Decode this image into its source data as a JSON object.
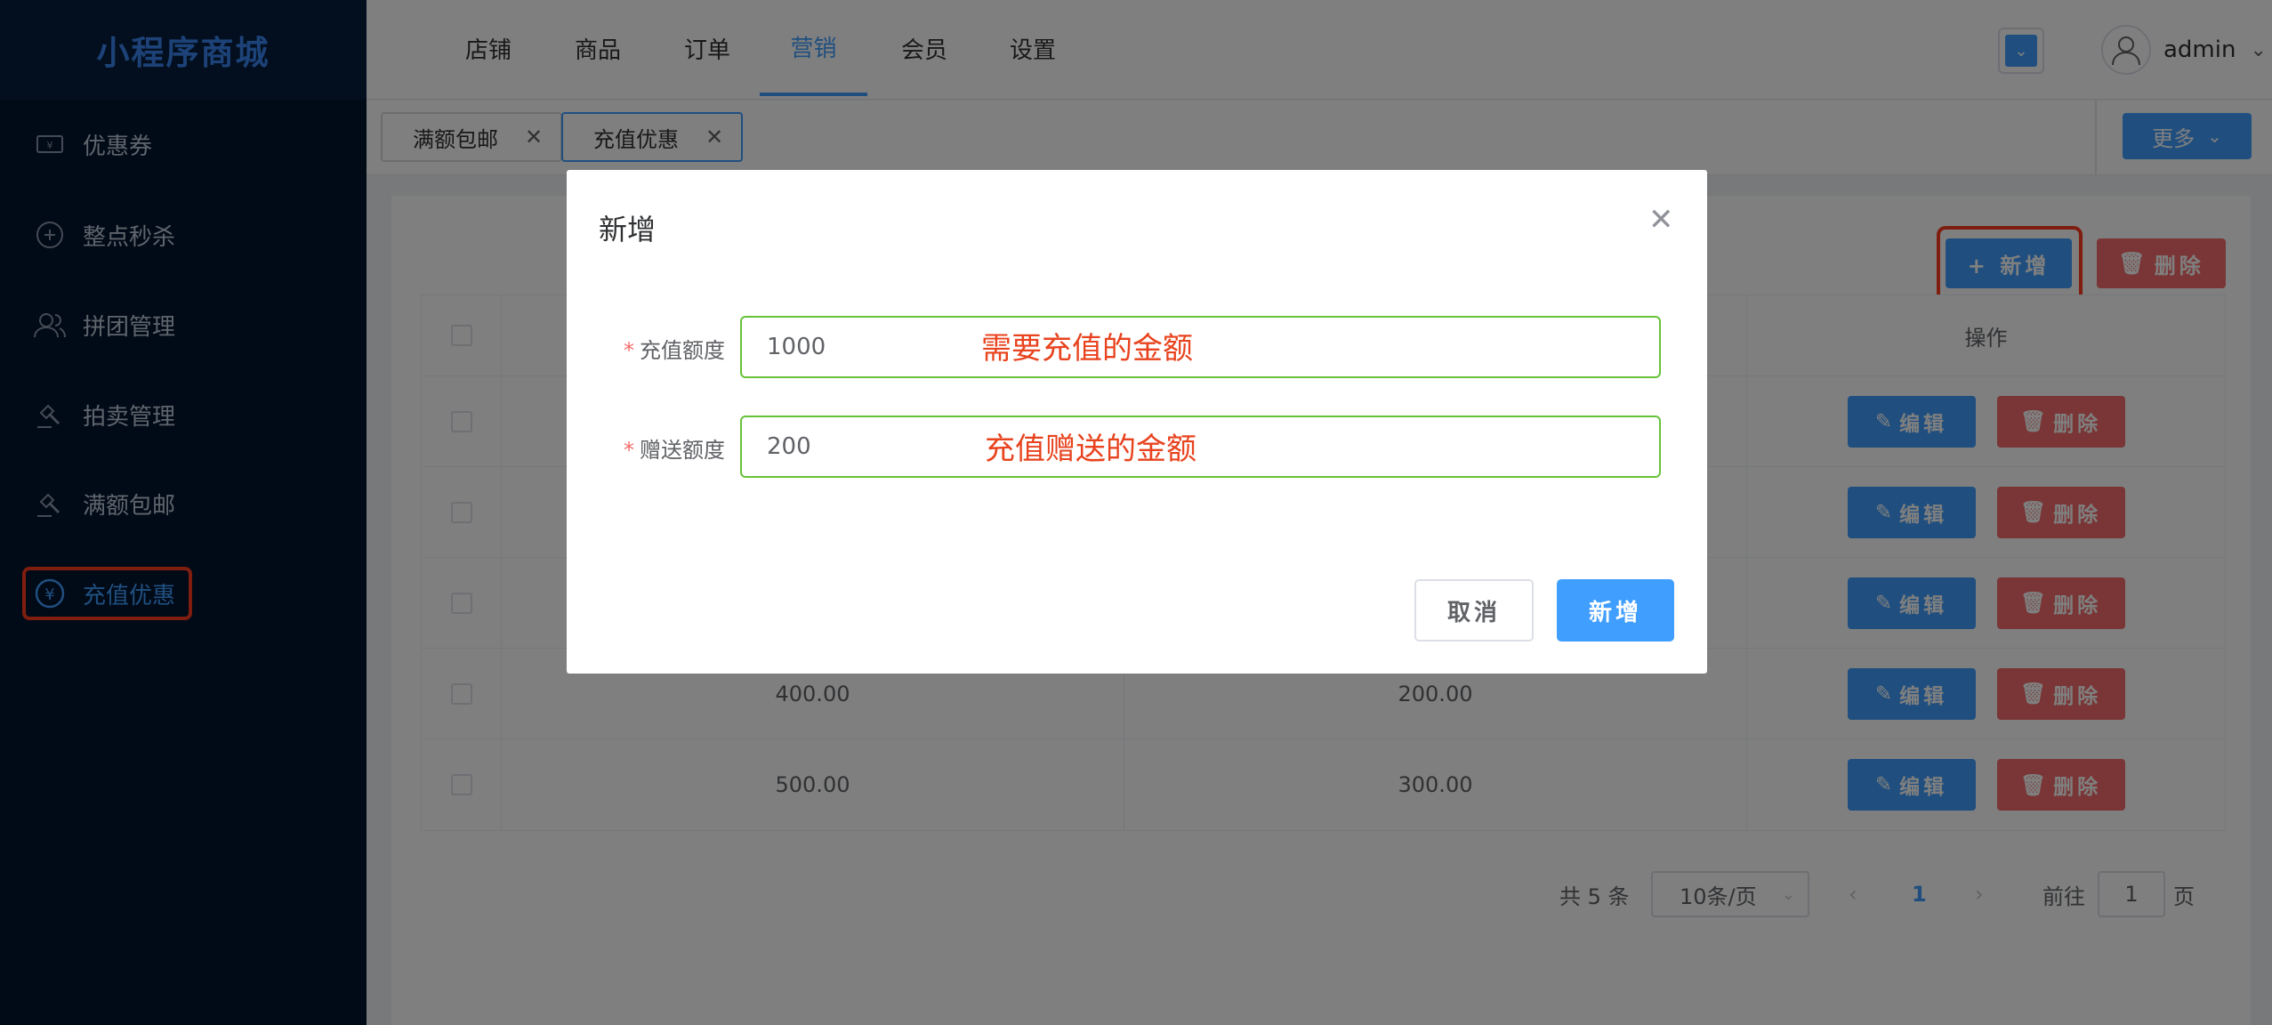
{
  "app": {
    "title": "小程序商城"
  },
  "sidebar": {
    "items": [
      {
        "label": "优惠券",
        "icon": "coupon-icon"
      },
      {
        "label": "整点秒杀",
        "icon": "flash-sale-icon"
      },
      {
        "label": "拼团管理",
        "icon": "group-icon"
      },
      {
        "label": "拍卖管理",
        "icon": "gavel-icon"
      },
      {
        "label": "满额包邮",
        "icon": "gavel-icon"
      },
      {
        "label": "充值优惠",
        "icon": "yen-icon",
        "active": true
      }
    ]
  },
  "topnav": {
    "items": [
      "店铺",
      "商品",
      "订单",
      "营销",
      "会员",
      "设置"
    ],
    "active": "营销",
    "user": "admin"
  },
  "tags": [
    {
      "label": "满额包邮"
    },
    {
      "label": "充值优惠",
      "active": true
    }
  ],
  "more_button": "更多",
  "toolbar": {
    "add_label": "+ 新增",
    "delete_label": "删除"
  },
  "table": {
    "header": {
      "action": "操作"
    },
    "rows": [
      {
        "amount": "",
        "gift": ""
      },
      {
        "amount": "",
        "gift": ""
      },
      {
        "amount": "",
        "gift": ""
      },
      {
        "amount": "400.00",
        "gift": "200.00"
      },
      {
        "amount": "500.00",
        "gift": "300.00"
      }
    ],
    "edit_label": "编辑",
    "delete_label": "删除"
  },
  "pagination": {
    "total": "共 5 条",
    "page_size": "10条/页",
    "current": "1",
    "goto_prefix": "前往",
    "goto_value": "1",
    "goto_suffix": "页"
  },
  "dialog": {
    "title": "新增",
    "fields": [
      {
        "label": "充值额度",
        "value": "1000",
        "annotation": "需要充值的金额"
      },
      {
        "label": "赠送额度",
        "value": "200",
        "annotation": "充值赠送的金额"
      }
    ],
    "cancel": "取消",
    "confirm": "新增"
  },
  "colors": {
    "primary": "#409eff",
    "danger": "#f56c6c",
    "sidebar": "#03142f",
    "highlight": "#ff3b1e",
    "success_border": "#67c23a"
  }
}
